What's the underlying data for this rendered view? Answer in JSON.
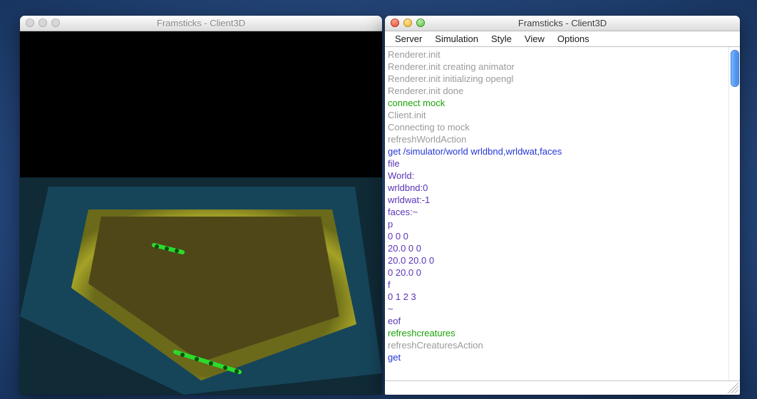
{
  "left_window": {
    "title": "Framsticks - Client3D"
  },
  "right_window": {
    "title": "Framsticks - Client3D",
    "menu": [
      "Server",
      "Simulation",
      "Style",
      "View",
      "Options"
    ],
    "log": [
      {
        "t": "Renderer.init",
        "c": "gray"
      },
      {
        "t": "Renderer.init creating animator",
        "c": "gray"
      },
      {
        "t": "Renderer.init initializing opengl",
        "c": "gray"
      },
      {
        "t": "Renderer.init done",
        "c": "gray"
      },
      {
        "t": "connect mock",
        "c": "green"
      },
      {
        "t": "Client.init",
        "c": "gray"
      },
      {
        "t": "Connecting to mock",
        "c": "gray"
      },
      {
        "t": "refreshWorldAction",
        "c": "gray"
      },
      {
        "t": "get /simulator/world wrldbnd,wrldwat,faces",
        "c": "blue"
      },
      {
        "t": "file",
        "c": "purple"
      },
      {
        "t": "World:",
        "c": "purple"
      },
      {
        "t": "wrldbnd:0",
        "c": "purple"
      },
      {
        "t": "wrldwat:-1",
        "c": "purple"
      },
      {
        "t": "faces:~",
        "c": "purple"
      },
      {
        "t": "p",
        "c": "purple"
      },
      {
        "t": "0 0 0",
        "c": "purple"
      },
      {
        "t": "20.0 0 0",
        "c": "purple"
      },
      {
        "t": "20.0 20.0 0",
        "c": "purple"
      },
      {
        "t": "0 20.0 0",
        "c": "purple"
      },
      {
        "t": "f",
        "c": "purple"
      },
      {
        "t": "0 1 2 3",
        "c": "purple"
      },
      {
        "t": "~",
        "c": "purple"
      },
      {
        "t": "",
        "c": "purple"
      },
      {
        "t": "eof",
        "c": "purple"
      },
      {
        "t": "refreshcreatures",
        "c": "green"
      },
      {
        "t": "refreshCreaturesAction",
        "c": "gray"
      },
      {
        "t": "get",
        "c": "blue"
      }
    ],
    "input_value": ""
  }
}
